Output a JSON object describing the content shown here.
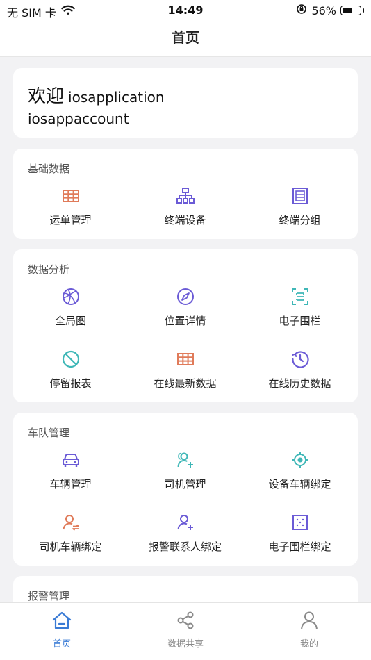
{
  "status_bar": {
    "carrier": "无 SIM 卡",
    "time": "14:49",
    "battery_percent": "56%",
    "battery_level": 0.56
  },
  "nav": {
    "title": "首页"
  },
  "welcome": {
    "greeting": "欢迎",
    "app_name": "iosapplication",
    "account": "iosappaccount"
  },
  "sections": {
    "basic": {
      "title": "基础数据",
      "items": [
        {
          "label": "运单管理",
          "icon": "table-icon",
          "color": "#e07b5a"
        },
        {
          "label": "终端设备",
          "icon": "hierarchy-icon",
          "color": "#6b5bd6"
        },
        {
          "label": "终端分组",
          "icon": "group-frame-icon",
          "color": "#6b5bd6"
        }
      ]
    },
    "analysis": {
      "title": "数据分析",
      "items": [
        {
          "label": "全局图",
          "icon": "globe-ball-icon",
          "color": "#6b5bd6"
        },
        {
          "label": "位置详情",
          "icon": "compass-icon",
          "color": "#6b5bd6"
        },
        {
          "label": "电子围栏",
          "icon": "scan-frame-icon",
          "color": "#3fb7b7"
        },
        {
          "label": "停留报表",
          "icon": "no-entry-icon",
          "color": "#3fb7b7"
        },
        {
          "label": "在线最新数据",
          "icon": "table-icon",
          "color": "#e07b5a"
        },
        {
          "label": "在线历史数据",
          "icon": "clock-history-icon",
          "color": "#6b5bd6"
        }
      ]
    },
    "fleet": {
      "title": "车队管理",
      "items": [
        {
          "label": "车辆管理",
          "icon": "car-icon",
          "color": "#6b5bd6"
        },
        {
          "label": "司机管理",
          "icon": "users-add-icon",
          "color": "#3fb7b7"
        },
        {
          "label": "设备车辆绑定",
          "icon": "locate-icon",
          "color": "#3fb7b7"
        },
        {
          "label": "司机车辆绑定",
          "icon": "user-swap-icon",
          "color": "#e07b5a"
        },
        {
          "label": "报警联系人绑定",
          "icon": "user-add-icon",
          "color": "#6b5bd6"
        },
        {
          "label": "电子围栏绑定",
          "icon": "dotted-square-icon",
          "color": "#6b5bd6"
        }
      ]
    },
    "alarm": {
      "title": "报警管理"
    }
  },
  "tabs": [
    {
      "label": "首页",
      "icon": "home-icon",
      "active": true
    },
    {
      "label": "数据共享",
      "icon": "share-icon",
      "active": false
    },
    {
      "label": "我的",
      "icon": "person-icon",
      "active": false
    }
  ],
  "colors": {
    "accent": "#3a7bd5",
    "orange": "#e07b5a",
    "purple": "#6b5bd6",
    "teal": "#3fb7b7"
  }
}
